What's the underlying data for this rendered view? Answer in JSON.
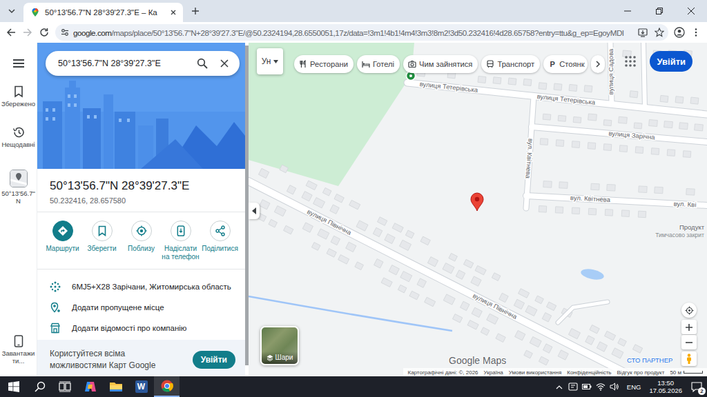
{
  "browser": {
    "tab": {
      "title": "50°13'56.7\"N 28°39'27.3\"E – Ка",
      "selected": true
    },
    "nav": {
      "back_enabled": true,
      "forward_enabled": false
    },
    "url": {
      "host": "google.com",
      "path": "/maps/place/50°13'56.7\"N+28°39'27.3\"E/@50.2324194,28.6550051,17z/data=!3m1!4b1!4m4!3m3!8m2!3d50.232416!4d28.65758?entry=ttu&g_ep=EgoyMDI"
    }
  },
  "rail": {
    "items": [
      {
        "label": "Збережено",
        "kind": "saved"
      },
      {
        "label": "Нещодавні",
        "kind": "recent"
      },
      {
        "label": "50°13'56.7\"N",
        "kind": "place"
      }
    ],
    "download": "Завантажити..."
  },
  "search": {
    "value": "50°13'56.7\"N 28°39'27.3\"E"
  },
  "place": {
    "title": "50°13'56.7\"N 28°39'27.3\"E",
    "coords": "50.232416, 28.657580"
  },
  "actions": [
    {
      "label": "Маршрути",
      "kind": "directions",
      "primary": true
    },
    {
      "label": "Зберегти",
      "kind": "save",
      "primary": false
    },
    {
      "label": "Поблизу",
      "kind": "nearby",
      "primary": false
    },
    {
      "label": "Надіслати на телефон",
      "kind": "phone",
      "primary": false
    },
    {
      "label": "Поділитися",
      "kind": "share",
      "primary": false
    }
  ],
  "details": [
    {
      "text": "6MJ5+X28 Зарічани, Житомирська область",
      "kind": "pluscode"
    },
    {
      "text": "Додати пропущене місце",
      "kind": "addplace"
    },
    {
      "text": "Додати відомості про компанію",
      "kind": "business"
    }
  ],
  "promo": {
    "text": "Користуйтеся всіма можливостями Карт Google",
    "button": "Увійти"
  },
  "map": {
    "language": "Ун",
    "chips": [
      {
        "label": "Ресторани",
        "kind": "restaurant"
      },
      {
        "label": "Готелі",
        "kind": "hotel"
      },
      {
        "label": "Чим зайнятися",
        "kind": "activity"
      },
      {
        "label": "Транспорт",
        "kind": "transit"
      },
      {
        "label": "Стоянк",
        "kind": "parking",
        "glyph": "P"
      }
    ],
    "signin": "Увійти",
    "street_labels": [
      "вулиця Тетерівська",
      "вулиця Тетерівська",
      "вулиця Садова",
      "вулиця Зарічна",
      "вул. Квітнева",
      "вул. Квітнева",
      "вул. Кві",
      "вулиця Північна",
      "вулиця Північна"
    ],
    "poi_labels": [
      "Продукт",
      "Тимчасово закрит"
    ],
    "partner": "СТО ПАРТНЕР",
    "layers": "Шари",
    "brand": "Google Maps",
    "attribution": [
      "Картографічні дані: ©, 2026",
      "Україна",
      "Умови використання",
      "Конфіденційність",
      "Відгук про продукт"
    ],
    "scale": "50 м"
  },
  "taskbar": {
    "apps": [
      {
        "kind": "copilot",
        "active": false
      },
      {
        "kind": "explorer",
        "active": false
      },
      {
        "kind": "word",
        "glyph": "W",
        "active": false
      },
      {
        "kind": "chrome",
        "active": true
      }
    ],
    "language": "ENG",
    "time": "13:50",
    "date": "17.05.2026",
    "notifications": "2"
  }
}
